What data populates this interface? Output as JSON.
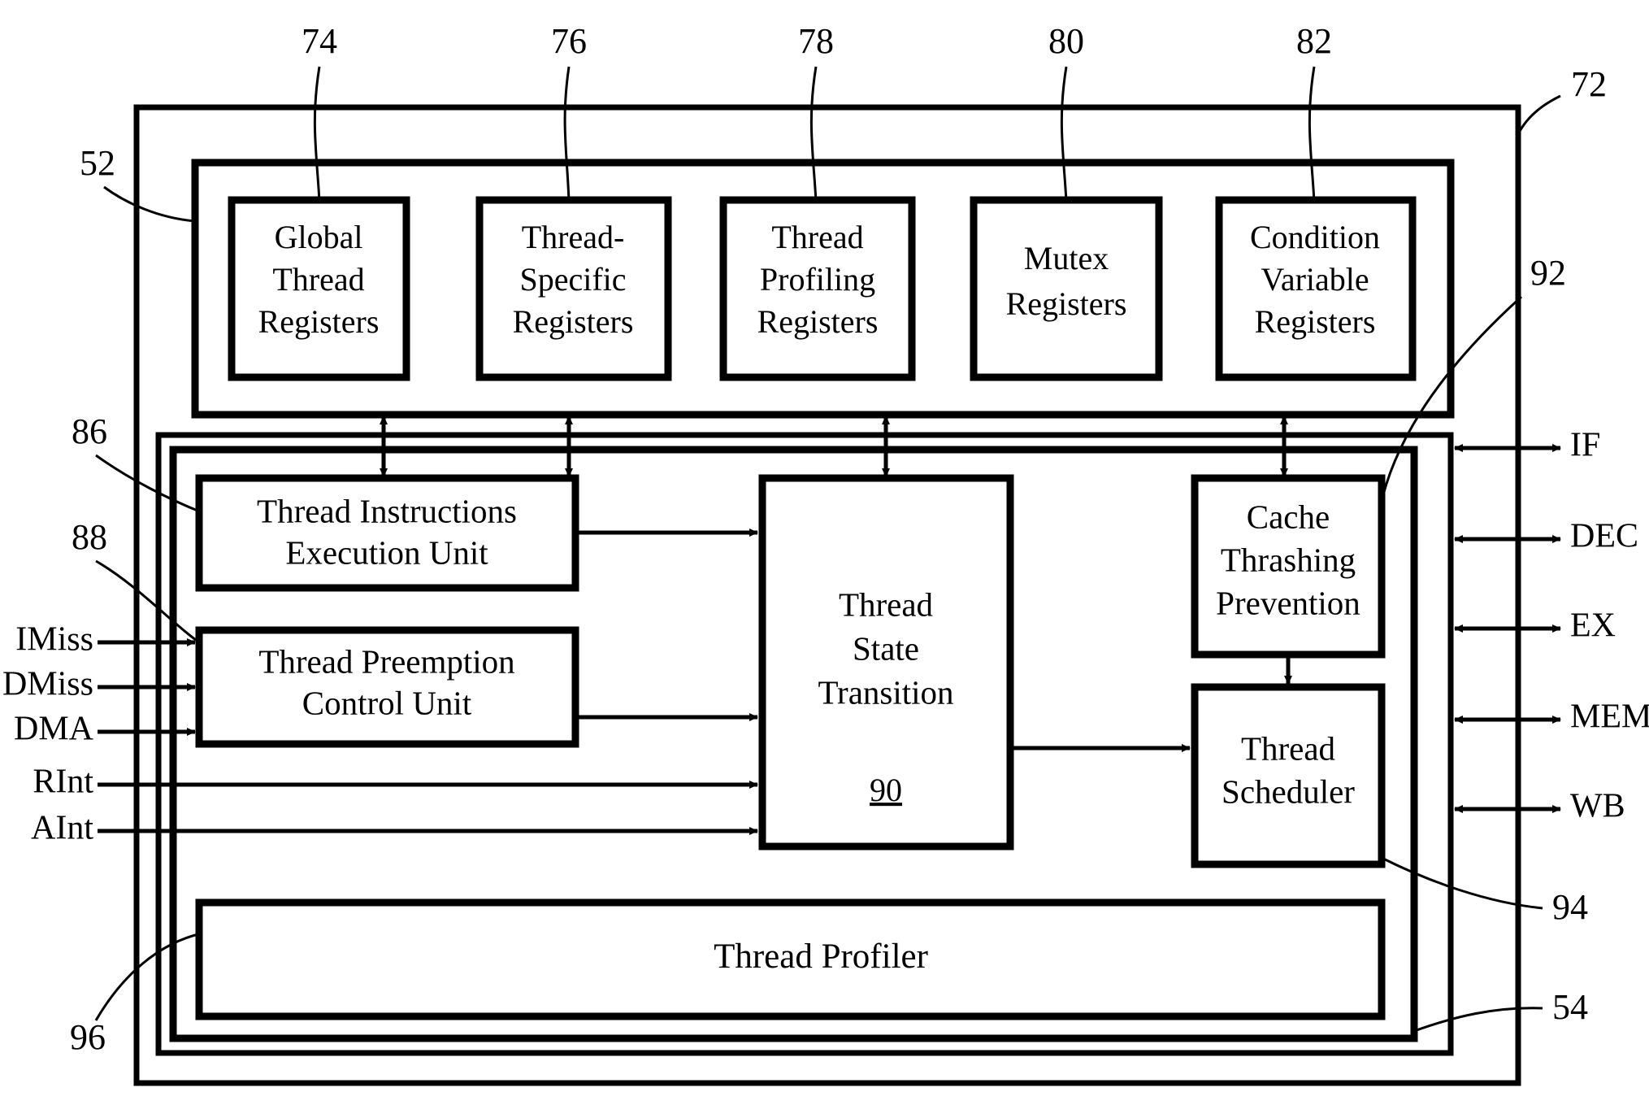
{
  "figure": {
    "title": "Multithreaded processor thread management unit block diagram",
    "stroke_color": "#000000",
    "background_color": "#ffffff"
  },
  "reference_numerals": {
    "outer_frame": "72",
    "register_file_frame": "52",
    "execution_frame": "54",
    "global_thread_registers": "74",
    "thread_specific_registers": "76",
    "thread_profiling_registers": "78",
    "mutex_registers": "80",
    "condition_variable_registers": "82",
    "thread_instructions_execution_unit": "86",
    "thread_preemption_control_unit": "88",
    "thread_state_transition": "90",
    "cache_thrashing_prevention": "92",
    "thread_scheduler": "94",
    "thread_profiler": "96"
  },
  "register_blocks": [
    {
      "id": "global-thread-registers",
      "lines": [
        "Global",
        "Thread",
        "Registers"
      ],
      "ref": "74"
    },
    {
      "id": "thread-specific-registers",
      "lines": [
        "Thread-",
        "Specific",
        "Registers"
      ],
      "ref": "76"
    },
    {
      "id": "thread-profiling-registers",
      "lines": [
        "Thread",
        "Profiling",
        "Registers"
      ],
      "ref": "78"
    },
    {
      "id": "mutex-registers",
      "lines": [
        "Mutex",
        "Registers"
      ],
      "ref": "80"
    },
    {
      "id": "condition-variable-registers",
      "lines": [
        "Condition",
        "Variable",
        "Registers"
      ],
      "ref": "82"
    }
  ],
  "logic_blocks": [
    {
      "id": "thread-instructions-execution-unit",
      "lines": [
        "Thread Instructions",
        "Execution Unit"
      ],
      "ref": "86"
    },
    {
      "id": "thread-preemption-control-unit",
      "lines": [
        "Thread Preemption",
        "Control Unit"
      ],
      "ref": "88"
    },
    {
      "id": "thread-state-transition",
      "lines": [
        "Thread",
        "State",
        "Transition"
      ],
      "ref": "90"
    },
    {
      "id": "cache-thrashing-prevention",
      "lines": [
        "Cache",
        "Thrashing",
        "Prevention"
      ],
      "ref": "92"
    },
    {
      "id": "thread-scheduler",
      "lines": [
        "Thread",
        "Scheduler"
      ],
      "ref": "94"
    },
    {
      "id": "thread-profiler",
      "lines": [
        "Thread Profiler"
      ],
      "ref": "96"
    }
  ],
  "input_signals": [
    {
      "id": "imiss",
      "label": "IMiss"
    },
    {
      "id": "dmiss",
      "label": "DMiss"
    },
    {
      "id": "dma",
      "label": "DMA"
    },
    {
      "id": "rint",
      "label": "RInt"
    },
    {
      "id": "aint",
      "label": "AInt"
    }
  ],
  "pipeline_stages": [
    {
      "id": "if",
      "label": "IF"
    },
    {
      "id": "dec",
      "label": "DEC"
    },
    {
      "id": "ex",
      "label": "EX"
    },
    {
      "id": "mem",
      "label": "MEM"
    },
    {
      "id": "wb",
      "label": "WB"
    }
  ],
  "labels": {
    "global_thread_registers_l1": "Global",
    "global_thread_registers_l2": "Thread",
    "global_thread_registers_l3": "Registers",
    "thread_specific_registers_l1": "Thread-",
    "thread_specific_registers_l2": "Specific",
    "thread_specific_registers_l3": "Registers",
    "thread_profiling_registers_l1": "Thread",
    "thread_profiling_registers_l2": "Profiling",
    "thread_profiling_registers_l3": "Registers",
    "mutex_registers_l1": "Mutex",
    "mutex_registers_l2": "Registers",
    "condition_variable_registers_l1": "Condition",
    "condition_variable_registers_l2": "Variable",
    "condition_variable_registers_l3": "Registers",
    "tieu_l1": "Thread Instructions",
    "tieu_l2": "Execution Unit",
    "tpcu_l1": "Thread Preemption",
    "tpcu_l2": "Control Unit",
    "tst_l1": "Thread",
    "tst_l2": "State",
    "tst_l3": "Transition",
    "tst_ref": "90",
    "ctp_l1": "Cache",
    "ctp_l2": "Thrashing",
    "ctp_l3": "Prevention",
    "sched_l1": "Thread",
    "sched_l2": "Scheduler",
    "profiler_l1": "Thread Profiler",
    "sig_imiss": "IMiss",
    "sig_dmiss": "DMiss",
    "sig_dma": "DMA",
    "sig_rint": "RInt",
    "sig_aint": "AInt",
    "stage_if": "IF",
    "stage_dec": "DEC",
    "stage_ex": "EX",
    "stage_mem": "MEM",
    "stage_wb": "WB",
    "ref_72": "72",
    "ref_52": "52",
    "ref_74": "74",
    "ref_76": "76",
    "ref_78": "78",
    "ref_80": "80",
    "ref_82": "82",
    "ref_86": "86",
    "ref_88": "88",
    "ref_92": "92",
    "ref_94": "94",
    "ref_96": "96",
    "ref_54": "54"
  }
}
